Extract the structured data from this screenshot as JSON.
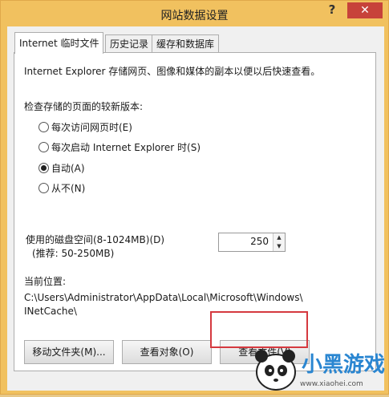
{
  "window": {
    "title": "网站数据设置",
    "help": "?",
    "close": "✕"
  },
  "tabs": [
    {
      "label": "Internet 临时文件"
    },
    {
      "label": "历史记录"
    },
    {
      "label": "缓存和数据库"
    }
  ],
  "panel": {
    "description": "Internet Explorer 存储网页、图像和媒体的副本以便以后快速查看。",
    "check_label": "检查存储的页面的较新版本:",
    "options": [
      {
        "label": "每次访问网页时(E)",
        "checked": false
      },
      {
        "label": "每次启动 Internet Explorer 时(S)",
        "checked": false
      },
      {
        "label": "自动(A)",
        "checked": true
      },
      {
        "label": "从不(N)",
        "checked": false
      }
    ],
    "disk_label": "使用的磁盘空间(8-1024MB)(D)",
    "disk_hint": "(推荐: 50-250MB)",
    "disk_value": "250",
    "location_label": "当前位置:",
    "location_line1": "C:\\Users\\Administrator\\AppData\\Local\\Microsoft\\Windows\\",
    "location_line2": "INetCache\\"
  },
  "buttons": {
    "move_folder": "移动文件夹(M)...",
    "view_objects": "查看对象(O)",
    "view_files": "查看文件(V)"
  },
  "watermark": {
    "brand": "小黑游戏",
    "url": "www.xiaohei.com"
  }
}
